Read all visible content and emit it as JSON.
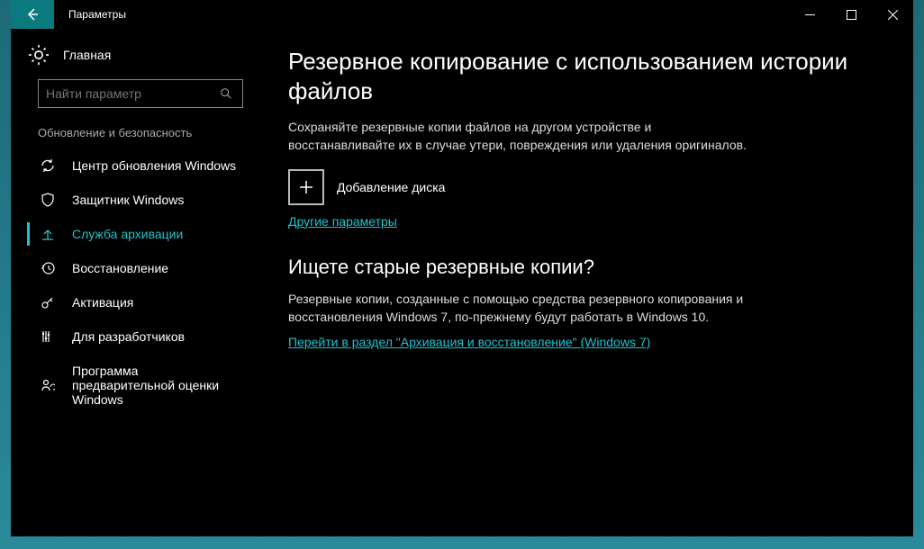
{
  "window": {
    "title": "Параметры"
  },
  "sidebar": {
    "home_label": "Главная",
    "search_placeholder": "Найти параметр",
    "section_label": "Обновление и безопасность",
    "items": [
      {
        "label": "Центр обновления Windows"
      },
      {
        "label": "Защитник Windows"
      },
      {
        "label": "Служба архивации"
      },
      {
        "label": "Восстановление"
      },
      {
        "label": "Активация"
      },
      {
        "label": "Для разработчиков"
      },
      {
        "label": "Программа предварительной оценки Windows"
      }
    ]
  },
  "content": {
    "heading1": "Резервное копирование с использованием истории файлов",
    "desc1": "Сохраняйте резервные копии файлов на другом устройстве и восстанавливайте их в случае утери, повреждения или удаления оригиналов.",
    "add_drive_label": "Добавление диска",
    "more_options": "Другие параметры",
    "heading2": "Ищете старые резервные копии?",
    "desc2": "Резервные копии, созданные с помощью средства резервного копирования и восстановления Windows 7, по-прежнему будут работать в Windows 10.",
    "link2": "Перейти в раздел \"Архивация и восстановление\" (Windows 7)"
  }
}
